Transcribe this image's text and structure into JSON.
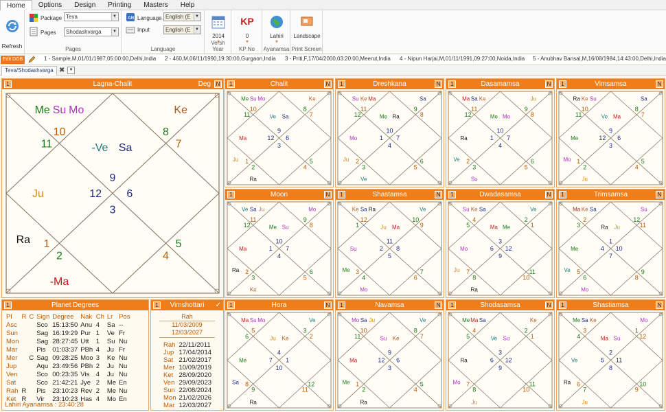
{
  "menu": [
    "Home",
    "Options",
    "Design",
    "Printing",
    "Masters",
    "Help"
  ],
  "ribbon": {
    "refresh": "Refresh",
    "package_label": "Package",
    "package_value": "Teva",
    "pages_label": "Pages",
    "pages_value": "Shodashvarga",
    "pages_group": "Pages",
    "language_label": "Language",
    "language_value": "English (E",
    "input_label": "Input",
    "input_value": "English (E",
    "language_group": "Language",
    "year_value": "2014",
    "year_label": "Versh Year",
    "kp_logo": "KP",
    "kp_value": "0",
    "kp_label": "KP No",
    "lahiri_value": "Lahiri",
    "lahiri_label": "Ayanamsa",
    "landscape_value": "Landscape",
    "landscape_label": "Print Screen"
  },
  "edit_dob": "Edit DOB",
  "profiles": [
    "1 - Sample,M,01/01/1987,05:00:00,Delhi,India",
    "2 - 460,M,06/11/1990,19:30:00,Gurgaon,India",
    "3 - Priti,F,17/04/2000,03:20:00,Meerut,India",
    "4 - Nipun Harjai,M,01/11/1991,09:27:00,Noida,India",
    "5 - Anubhav Bansal,M,16/08/1984,14:43:00,Delhi,India"
  ],
  "tab_label": "Teva/Shodashvarga",
  "main_chart": {
    "title": "Lagna-Chalit",
    "num": "1",
    "deg": "Deg",
    "n": "N",
    "houses": [
      "9",
      "10",
      "11",
      "12",
      "1",
      "2",
      "3",
      "4",
      "5",
      "6",
      "7",
      "8"
    ],
    "planets": [
      {
        "t": "Me",
        "c": "#1a7a1a"
      },
      {
        "t": "Su",
        "c": "#b030c0"
      },
      {
        "t": "Mo",
        "c": "#b030c0"
      },
      {
        "t": "-Ve",
        "c": "#1a7a7a"
      },
      {
        "t": "Sa",
        "c": "#1d2a88"
      },
      {
        "t": "Ke",
        "c": "#b05a20"
      },
      {
        "t": "Ju",
        "c": "#d08a1a"
      },
      {
        "t": "Ra",
        "c": "#111111"
      },
      {
        "t": "-Ma",
        "c": "#c01a1a"
      }
    ]
  },
  "charts": [
    {
      "title": "Chalit",
      "num": "1",
      "n": "N",
      "houses": [
        "9",
        "10",
        "11",
        "12",
        "1",
        "2",
        "3",
        "4",
        "5",
        "6",
        "7",
        "8"
      ],
      "planets": [
        {
          "t": "Me",
          "c": "#1a7a1a"
        },
        {
          "t": "Su",
          "c": "#b030c0"
        },
        {
          "t": "Mo",
          "c": "#b030c0"
        },
        {
          "t": "Ve",
          "c": "#1a7a7a"
        },
        {
          "t": "Sa",
          "c": "#1d2a88"
        },
        {
          "t": "Ke",
          "c": "#b05a20"
        },
        {
          "t": "Ma",
          "c": "#c01a1a"
        },
        {
          "t": "Ju",
          "c": "#d08a1a"
        },
        {
          "t": "Ra",
          "c": "#111111"
        }
      ]
    },
    {
      "title": "Dreshkana",
      "num": "1",
      "n": "N",
      "houses": [
        "10",
        "11",
        "12",
        "1",
        "2",
        "3",
        "4",
        "5",
        "6",
        "7",
        "8",
        "9"
      ],
      "planets": [
        {
          "t": "Su",
          "c": "#b030c0"
        },
        {
          "t": "Ke",
          "c": "#b05a20"
        },
        {
          "t": "Ma",
          "c": "#c01a1a"
        },
        {
          "t": "Me",
          "c": "#1a7a1a"
        },
        {
          "t": "Ra",
          "c": "#111111"
        },
        {
          "t": "Sa",
          "c": "#1d2a88"
        },
        {
          "t": "Mo",
          "c": "#b030c0"
        },
        {
          "t": "Ju",
          "c": "#d08a1a"
        },
        {
          "t": "Ve",
          "c": "#1a7a7a"
        }
      ]
    },
    {
      "title": "Dasamamsa",
      "num": "1",
      "n": "N",
      "houses": [
        "10",
        "11",
        "12",
        "1",
        "2",
        "3",
        "4",
        "5",
        "6",
        "7",
        "8",
        "9"
      ],
      "planets": [
        {
          "t": "Ma",
          "c": "#c01a1a"
        },
        {
          "t": "Sa",
          "c": "#1d2a88"
        },
        {
          "t": "Ke",
          "c": "#b05a20"
        },
        {
          "t": "Me",
          "c": "#1a7a1a"
        },
        {
          "t": "Mo",
          "c": "#b030c0"
        },
        {
          "t": "Ju",
          "c": "#d08a1a"
        },
        {
          "t": "Ra",
          "c": "#111111"
        },
        {
          "t": "Ve",
          "c": "#1a7a7a"
        },
        {
          "t": "Su",
          "c": "#b030c0"
        }
      ]
    },
    {
      "title": "Vimsamsa",
      "num": "1",
      "n": "N",
      "houses": [
        "9",
        "10",
        "11",
        "12",
        "1",
        "2",
        "3",
        "4",
        "5",
        "6",
        "7",
        "8"
      ],
      "planets": [
        {
          "t": "Ra",
          "c": "#111111"
        },
        {
          "t": "Ke",
          "c": "#b05a20"
        },
        {
          "t": "Su",
          "c": "#b030c0"
        },
        {
          "t": "Ve",
          "c": "#1a7a7a"
        },
        {
          "t": "Ma",
          "c": "#c01a1a"
        },
        {
          "t": "Sa",
          "c": "#1d2a88"
        },
        {
          "t": "Me",
          "c": "#1a7a1a"
        },
        {
          "t": "Mo",
          "c": "#b030c0"
        },
        {
          "t": "Ju",
          "c": "#d08a1a"
        }
      ]
    },
    {
      "title": "Moon",
      "num": "1",
      "n": "N",
      "houses": [
        "10",
        "11",
        "12",
        "1",
        "2",
        "3",
        "4",
        "5",
        "6",
        "7",
        "8",
        "9"
      ],
      "planets": [
        {
          "t": "Ve",
          "c": "#1a7a7a"
        },
        {
          "t": "Sa",
          "c": "#1d2a88"
        },
        {
          "t": "Ju",
          "c": "#d08a1a"
        },
        {
          "t": "Me",
          "c": "#1a7a1a"
        },
        {
          "t": "Su",
          "c": "#b030c0"
        },
        {
          "t": "Mo",
          "c": "#b030c0"
        },
        {
          "t": "Ma",
          "c": "#c01a1a"
        },
        {
          "t": "Ra",
          "c": "#111111"
        },
        {
          "t": "Ke",
          "c": "#b05a20"
        }
      ]
    },
    {
      "title": "Shastamsa",
      "num": "1",
      "n": "N",
      "houses": [
        "11",
        "12",
        "1",
        "2",
        "3",
        "4",
        "5",
        "6",
        "7",
        "8",
        "9",
        "10"
      ],
      "planets": [
        {
          "t": "Ke",
          "c": "#b05a20"
        },
        {
          "t": "Sa",
          "c": "#1d2a88"
        },
        {
          "t": "Ra",
          "c": "#111111"
        },
        {
          "t": "Ju",
          "c": "#d08a1a"
        },
        {
          "t": "Ma",
          "c": "#c01a1a"
        },
        {
          "t": "Ve",
          "c": "#1a7a7a"
        },
        {
          "t": "Su",
          "c": "#b030c0"
        },
        {
          "t": "Me",
          "c": "#1a7a1a"
        },
        {
          "t": "Mo",
          "c": "#b030c0"
        }
      ]
    },
    {
      "title": "Dwadasamsa",
      "num": "1",
      "n": "N",
      "houses": [
        "3",
        "4",
        "5",
        "6",
        "7",
        "8",
        "9",
        "10",
        "11",
        "12",
        "1",
        "2"
      ],
      "planets": [
        {
          "t": "Su",
          "c": "#b030c0"
        },
        {
          "t": "Ke",
          "c": "#b05a20"
        },
        {
          "t": "Sa",
          "c": "#1d2a88"
        },
        {
          "t": "Ma",
          "c": "#c01a1a"
        },
        {
          "t": "Me",
          "c": "#1a7a1a"
        },
        {
          "t": "Ve",
          "c": "#1a7a7a"
        },
        {
          "t": "Mo",
          "c": "#b030c0"
        },
        {
          "t": "Ju",
          "c": "#d08a1a"
        },
        {
          "t": "Ra",
          "c": "#111111"
        }
      ]
    },
    {
      "title": "Trimsamsa",
      "num": "1",
      "n": "N",
      "houses": [
        "1",
        "2",
        "3",
        "4",
        "5",
        "6",
        "7",
        "8",
        "9",
        "10",
        "11",
        "12"
      ],
      "planets": [
        {
          "t": "Ma",
          "c": "#c01a1a"
        },
        {
          "t": "Ke",
          "c": "#b05a20"
        },
        {
          "t": "Sa",
          "c": "#1d2a88"
        },
        {
          "t": "Ra",
          "c": "#111111"
        },
        {
          "t": "Ju",
          "c": "#d08a1a"
        },
        {
          "t": "Su",
          "c": "#b030c0"
        },
        {
          "t": "Me",
          "c": "#1a7a1a"
        },
        {
          "t": "Ve",
          "c": "#1a7a7a"
        },
        {
          "t": "Mo",
          "c": "#b030c0"
        }
      ]
    },
    {
      "title": "Hora",
      "num": "1",
      "n": "N",
      "houses": [
        "4",
        "5",
        "6",
        "7",
        "8",
        "9",
        "10",
        "11",
        "12",
        "1",
        "2",
        "3"
      ],
      "planets": [
        {
          "t": "Ma",
          "c": "#c01a1a"
        },
        {
          "t": "Su",
          "c": "#b030c0"
        },
        {
          "t": "Mo",
          "c": "#b030c0"
        },
        {
          "t": "Ju",
          "c": "#d08a1a"
        },
        {
          "t": "Ke",
          "c": "#b05a20"
        },
        {
          "t": "Ve",
          "c": "#1a7a7a"
        },
        {
          "t": "Me",
          "c": "#1a7a1a"
        },
        {
          "t": "Sa",
          "c": "#1d2a88"
        },
        {
          "t": "Ra",
          "c": "#111111"
        }
      ]
    },
    {
      "title": "Navamsa",
      "num": "1",
      "n": "N",
      "houses": [
        "9",
        "10",
        "11",
        "12",
        "1",
        "2",
        "3",
        "4",
        "5",
        "6",
        "7",
        "8"
      ],
      "planets": [
        {
          "t": "Mo",
          "c": "#b030c0"
        },
        {
          "t": "Sa",
          "c": "#1d2a88"
        },
        {
          "t": "Ju",
          "c": "#d08a1a"
        },
        {
          "t": "Su",
          "c": "#b030c0"
        },
        {
          "t": "Ke",
          "c": "#b05a20"
        },
        {
          "t": "Ve",
          "c": "#1a7a7a"
        },
        {
          "t": "Ma",
          "c": "#c01a1a"
        },
        {
          "t": "Me",
          "c": "#1a7a1a"
        },
        {
          "t": "Ra",
          "c": "#111111"
        }
      ]
    },
    {
      "title": "Shodasamsa",
      "num": "1",
      "n": "N",
      "houses": [
        "3",
        "4",
        "5",
        "6",
        "7",
        "8",
        "9",
        "10",
        "11",
        "12",
        "1",
        "2"
      ],
      "planets": [
        {
          "t": "Me",
          "c": "#1a7a1a"
        },
        {
          "t": "Ma",
          "c": "#c01a1a"
        },
        {
          "t": "Sa",
          "c": "#1d2a88"
        },
        {
          "t": "Ve",
          "c": "#1a7a7a"
        },
        {
          "t": "Su",
          "c": "#b030c0"
        },
        {
          "t": "Ke",
          "c": "#b05a20"
        },
        {
          "t": "Ra",
          "c": "#111111"
        },
        {
          "t": "Mo",
          "c": "#b030c0"
        },
        {
          "t": "Ju",
          "c": "#d08a1a"
        }
      ]
    },
    {
      "title": "Shastiamsa",
      "num": "1",
      "n": "N",
      "houses": [
        "2",
        "3",
        "4",
        "5",
        "6",
        "7",
        "8",
        "9",
        "10",
        "11",
        "12",
        "1"
      ],
      "planets": [
        {
          "t": "Me",
          "c": "#1a7a1a"
        },
        {
          "t": "Sa",
          "c": "#1d2a88"
        },
        {
          "t": "Ke",
          "c": "#b05a20"
        },
        {
          "t": "Ma",
          "c": "#c01a1a"
        },
        {
          "t": "Su",
          "c": "#b030c0"
        },
        {
          "t": "Mo",
          "c": "#b030c0"
        },
        {
          "t": "Ve",
          "c": "#1a7a7a"
        },
        {
          "t": "Ra",
          "c": "#111111"
        },
        {
          "t": "Ju",
          "c": "#d08a1a"
        }
      ]
    }
  ],
  "planet_degrees": {
    "title": "Planet Degrees",
    "num": "1",
    "headers": [
      "Pl",
      "R",
      "C",
      "Sign",
      "Degree",
      "Nak",
      "Ch",
      "Lr",
      "Pos"
    ],
    "rows": [
      [
        "Asc",
        "",
        "",
        "Sco",
        "15:13:50",
        "Anu",
        "4",
        "Sa",
        "--"
      ],
      [
        "Sun",
        "",
        "",
        "Sag",
        "16:19:29",
        "Pur",
        "1",
        "Ve",
        "Fr"
      ],
      [
        "Mon",
        "",
        "",
        "Sag",
        "28:27:45",
        "Utt",
        "1",
        "Su",
        "Nu"
      ],
      [
        "Mar",
        "",
        "",
        "Pis",
        "01:03:37",
        "PBh",
        "4",
        "Ju",
        "Fr"
      ],
      [
        "Mer",
        "",
        "C",
        "Sag",
        "09:28:25",
        "Moo",
        "3",
        "Ke",
        "Nu"
      ],
      [
        "Jup",
        "",
        "",
        "Aqu",
        "23:49:56",
        "PBh",
        "2",
        "Ju",
        "Nu"
      ],
      [
        "Ven",
        "",
        "",
        "Sco",
        "00:23:35",
        "Vis",
        "4",
        "Ju",
        "Nu"
      ],
      [
        "Sat",
        "",
        "",
        "Sco",
        "21:42:21",
        "Jye",
        "2",
        "Me",
        "En"
      ],
      [
        "Rah",
        "R",
        "",
        "Pis",
        "23:10:23",
        "Rev",
        "2",
        "Me",
        "Nu"
      ],
      [
        "Ket",
        "R",
        "",
        "Vir",
        "23:10:23",
        "Has",
        "4",
        "Mo",
        "En"
      ]
    ],
    "ayanamsa": "Lahiri Ayanamsa : 23:40:28"
  },
  "vimshottari": {
    "title": "Vimshottari",
    "num": "1",
    "check": "✓",
    "current": "Rah",
    "from": "11/03/2009",
    "to": "12/03/2027",
    "rows": [
      [
        "Rah",
        "22/11/2011"
      ],
      [
        "Jup",
        "17/04/2014"
      ],
      [
        "Sat",
        "21/02/2017"
      ],
      [
        "Mer",
        "10/09/2019"
      ],
      [
        "Ket",
        "28/09/2020"
      ],
      [
        "Ven",
        "29/09/2023"
      ],
      [
        "Sun",
        "22/08/2024"
      ],
      [
        "Mon",
        "21/02/2026"
      ],
      [
        "Mar",
        "12/03/2027"
      ]
    ]
  }
}
